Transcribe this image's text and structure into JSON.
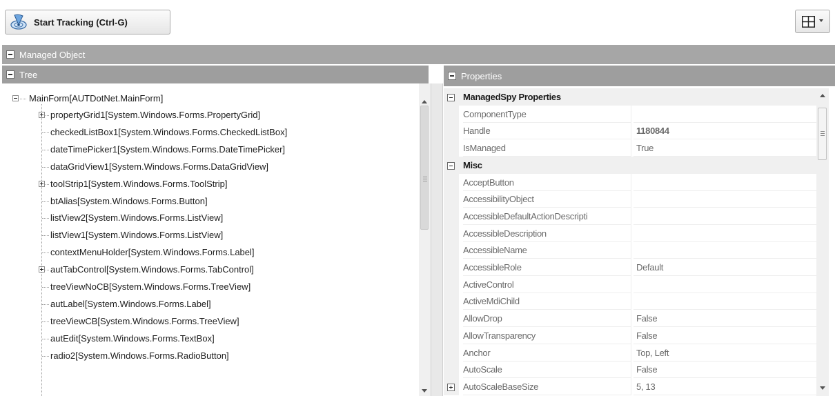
{
  "toolbar": {
    "start_tracking_label": "Start Tracking (Ctrl-G)",
    "start_tracking_icon": "radar-tracking-icon",
    "layout_icon": "grid-layout-icon"
  },
  "sections": {
    "managed_object": "Managed Object",
    "tree": "Tree",
    "properties": "Properties"
  },
  "tree": {
    "root": "MainForm[AUTDotNet.MainForm]",
    "items": [
      {
        "label": "propertyGrid1[System.Windows.Forms.PropertyGrid]",
        "expandable": true
      },
      {
        "label": "checkedListBox1[System.Windows.Forms.CheckedListBox]",
        "expandable": false
      },
      {
        "label": "dateTimePicker1[System.Windows.Forms.DateTimePicker]",
        "expandable": false
      },
      {
        "label": "dataGridView1[System.Windows.Forms.DataGridView]",
        "expandable": false
      },
      {
        "label": "toolStrip1[System.Windows.Forms.ToolStrip]",
        "expandable": true
      },
      {
        "label": "btAlias[System.Windows.Forms.Button]",
        "expandable": false
      },
      {
        "label": "listView2[System.Windows.Forms.ListView]",
        "expandable": false
      },
      {
        "label": "listView1[System.Windows.Forms.ListView]",
        "expandable": false
      },
      {
        "label": "contextMenuHolder[System.Windows.Forms.Label]",
        "expandable": false
      },
      {
        "label": "autTabControl[System.Windows.Forms.TabControl]",
        "expandable": true
      },
      {
        "label": "treeViewNoCB[System.Windows.Forms.TreeView]",
        "expandable": false
      },
      {
        "label": "autLabel[System.Windows.Forms.Label]",
        "expandable": false
      },
      {
        "label": "treeViewCB[System.Windows.Forms.TreeView]",
        "expandable": false
      },
      {
        "label": "autEdit[System.Windows.Forms.TextBox]",
        "expandable": false
      },
      {
        "label": "radio2[System.Windows.Forms.RadioButton]",
        "expandable": false
      }
    ]
  },
  "properties": {
    "rows": [
      {
        "kind": "category",
        "name": "ManagedSpy Properties"
      },
      {
        "kind": "prop",
        "name": "ComponentType",
        "value": ""
      },
      {
        "kind": "prop",
        "name": "Handle",
        "value": "1180844",
        "bold": true
      },
      {
        "kind": "prop",
        "name": "IsManaged",
        "value": "True"
      },
      {
        "kind": "category",
        "name": "Misc"
      },
      {
        "kind": "prop",
        "name": "AcceptButton",
        "value": ""
      },
      {
        "kind": "prop",
        "name": "AccessibilityObject",
        "value": ""
      },
      {
        "kind": "prop",
        "name": "AccessibleDefaultActionDescripti",
        "value": ""
      },
      {
        "kind": "prop",
        "name": "AccessibleDescription",
        "value": ""
      },
      {
        "kind": "prop",
        "name": "AccessibleName",
        "value": ""
      },
      {
        "kind": "prop",
        "name": "AccessibleRole",
        "value": "Default"
      },
      {
        "kind": "prop",
        "name": "ActiveControl",
        "value": ""
      },
      {
        "kind": "prop",
        "name": "ActiveMdiChild",
        "value": ""
      },
      {
        "kind": "prop",
        "name": "AllowDrop",
        "value": "False"
      },
      {
        "kind": "prop",
        "name": "AllowTransparency",
        "value": "False"
      },
      {
        "kind": "prop",
        "name": "Anchor",
        "value": "Top, Left"
      },
      {
        "kind": "prop",
        "name": "AutoScale",
        "value": "False"
      },
      {
        "kind": "prop",
        "name": "AutoScaleBaseSize",
        "value": "5, 13",
        "expandable": true
      }
    ]
  }
}
